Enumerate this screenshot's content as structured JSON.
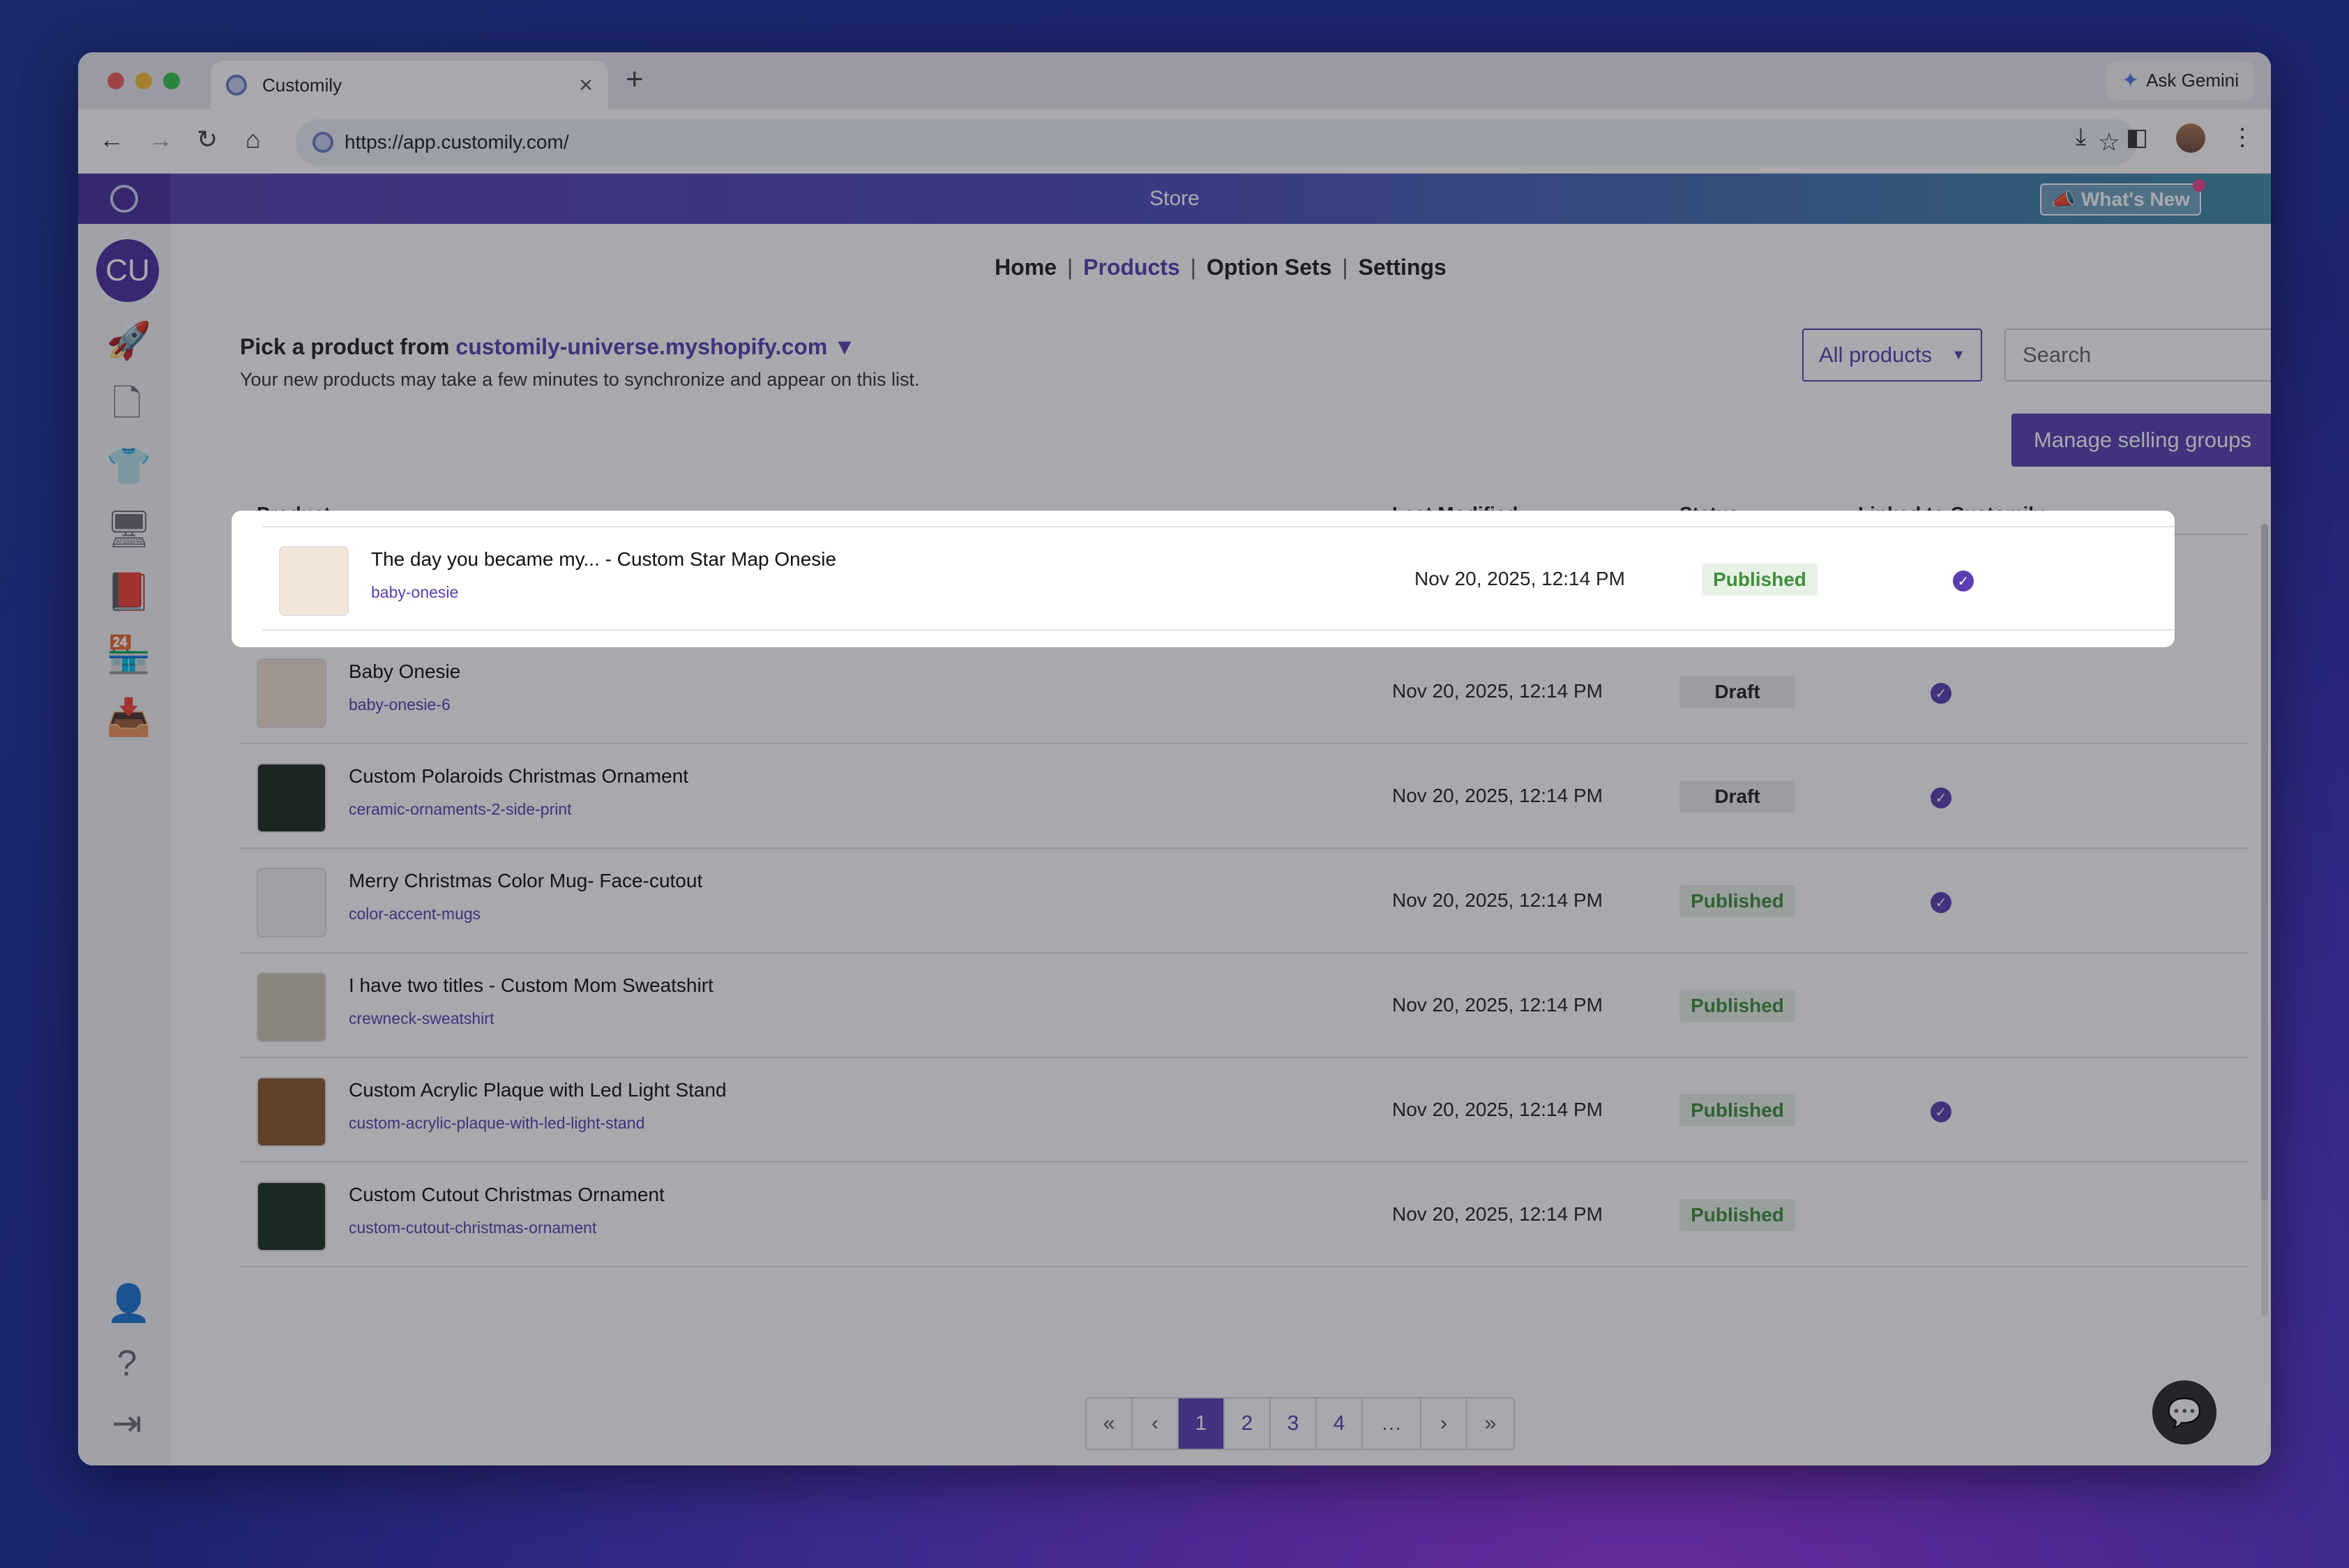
{
  "browser": {
    "tab_title": "Customily",
    "new_tab": "+",
    "tab_close": "×",
    "ask_gemini": "Ask Gemini",
    "url": "https://app.customily.com/"
  },
  "app": {
    "store_title": "Store",
    "whats_new": "What's New",
    "avatar_initials": "CU"
  },
  "nav": {
    "home": "Home",
    "products": "Products",
    "option_sets": "Option Sets",
    "settings": "Settings",
    "separator": "|"
  },
  "header": {
    "pick_prefix": "Pick a product from",
    "store_domain": "customily-universe.myshopify.com",
    "store_caret": "▼",
    "subtext": "Your new products may take a few minutes to synchronize and appear on this list.",
    "filter_value": "All products",
    "search_placeholder": "Search",
    "manage_button": "Manage selling groups"
  },
  "table": {
    "columns": {
      "product": "Product",
      "last_modified": "Last Modified",
      "status": "Status",
      "linked": "Linked to Customily"
    },
    "rows": [
      {
        "name": "The day you became my... - Custom Star Map Onesie",
        "handle": "baby-onesie",
        "modified": "Nov 20, 2025, 12:14 PM",
        "status": "Published",
        "linked": true
      },
      {
        "name": "Baby Onesie",
        "handle": "baby-onesie-6",
        "modified": "Nov 20, 2025, 12:14 PM",
        "status": "Draft",
        "linked": true
      },
      {
        "name": "Custom Polaroids Christmas Ornament",
        "handle": "ceramic-ornaments-2-side-print",
        "modified": "Nov 20, 2025, 12:14 PM",
        "status": "Draft",
        "linked": true
      },
      {
        "name": "Merry Christmas Color Mug- Face-cutout",
        "handle": "color-accent-mugs",
        "modified": "Nov 20, 2025, 12:14 PM",
        "status": "Published",
        "linked": true
      },
      {
        "name": "I have two titles - Custom Mom Sweatshirt",
        "handle": "crewneck-sweatshirt",
        "modified": "Nov 20, 2025, 12:14 PM",
        "status": "Published",
        "linked": false
      },
      {
        "name": "Custom Acrylic Plaque with Led Light Stand",
        "handle": "custom-acrylic-plaque-with-led-light-stand",
        "modified": "Nov 20, 2025, 12:14 PM",
        "status": "Published",
        "linked": true
      },
      {
        "name": "Custom Cutout Christmas Ornament",
        "handle": "custom-cutout-christmas-ornament",
        "modified": "Nov 20, 2025, 12:14 PM",
        "status": "Published",
        "linked": false
      }
    ]
  },
  "pagination": {
    "first": "«",
    "prev": "‹",
    "pages": [
      "1",
      "2",
      "3",
      "4"
    ],
    "ellipsis": "…",
    "next": "›",
    "last": "»",
    "current": "1"
  },
  "colors": {
    "accent": "#5b3fb0",
    "published_text": "#3f8e3a",
    "published_bg": "#e7f1e6"
  }
}
